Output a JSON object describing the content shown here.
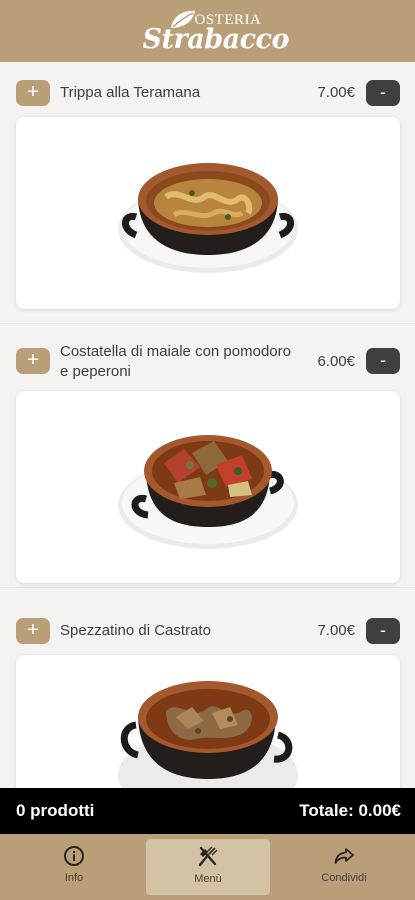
{
  "header": {
    "logo_top": "OSTERIA",
    "logo_main": "Strabacco"
  },
  "items": [
    {
      "name": "Trippa alla Teramana",
      "price": "7.00€",
      "add_label": "+",
      "remove_label": "-"
    },
    {
      "name": "Costatella di maiale con pomodoro e peperoni",
      "price": "6.00€",
      "add_label": "+",
      "remove_label": "-"
    },
    {
      "name": "Spezzatino di Castrato",
      "price": "7.00€",
      "add_label": "+",
      "remove_label": "-"
    }
  ],
  "cart": {
    "count_text": "0 prodotti",
    "total_text": "Totale: 0.00€"
  },
  "nav": [
    {
      "label": "Info",
      "icon": "info-icon"
    },
    {
      "label": "Menù",
      "icon": "cutlery-icon",
      "active": true
    },
    {
      "label": "Condividi",
      "icon": "share-icon"
    }
  ],
  "colors": {
    "brand": "#b89f78",
    "brand_light": "#d4c2a4",
    "dark_button": "#3f3f3f",
    "cart_bar": "#000000"
  }
}
